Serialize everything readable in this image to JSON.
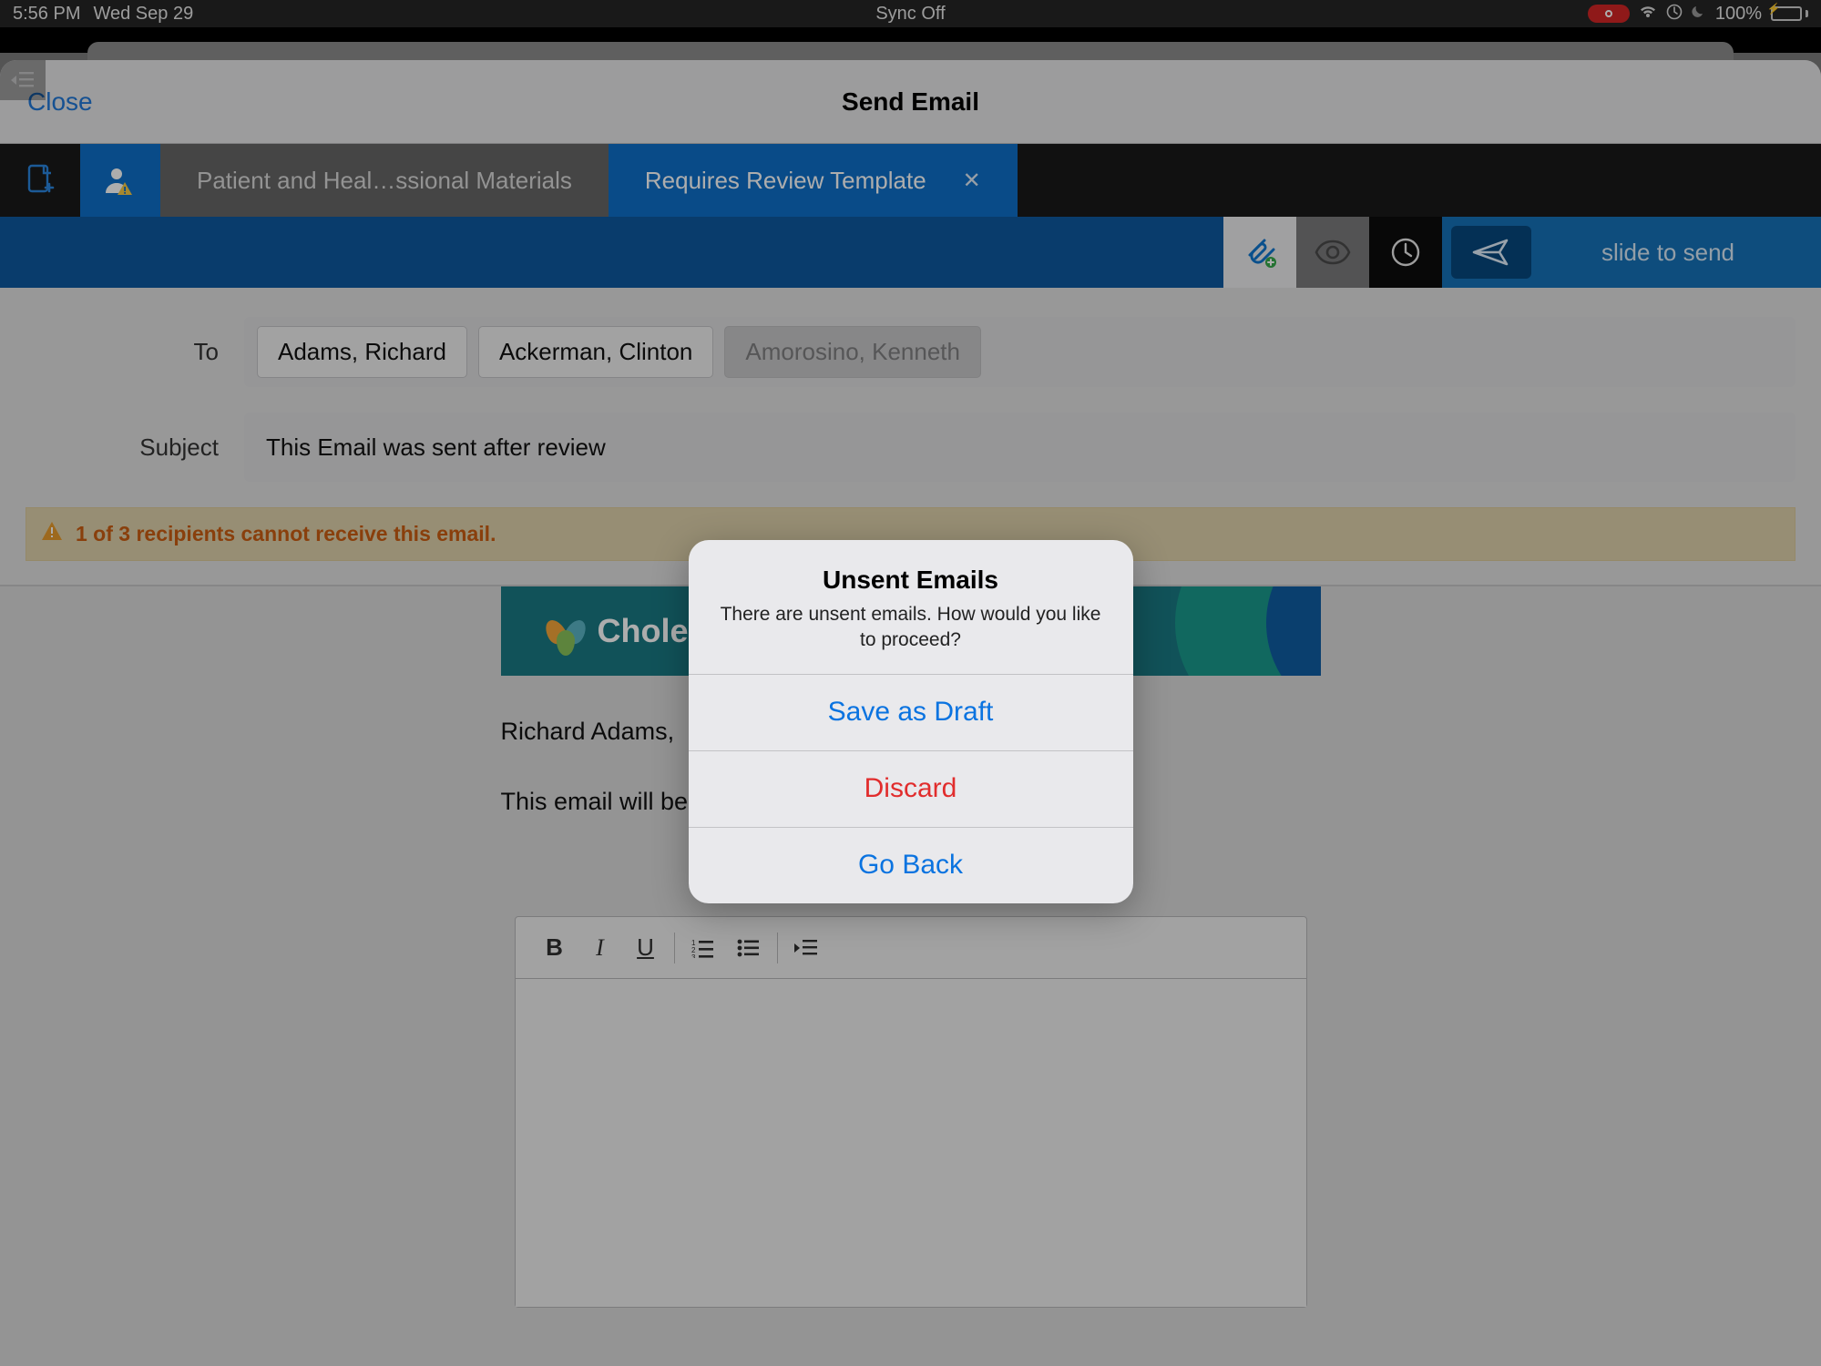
{
  "statusbar": {
    "time": "5:56 PM",
    "date": "Wed Sep 29",
    "center": "Sync Off",
    "battery_pct": "100%"
  },
  "sheet": {
    "close": "Close",
    "title": "Send Email"
  },
  "tabs": {
    "inactive": "Patient and Heal…ssional Materials",
    "active": "Requires Review Template"
  },
  "actionbar": {
    "slide_label": "slide to send"
  },
  "compose": {
    "to_label": "To",
    "subject_label": "Subject",
    "recipients": [
      {
        "name": "Adams, Richard",
        "disabled": false
      },
      {
        "name": "Ackerman, Clinton",
        "disabled": false
      },
      {
        "name": "Amorosino, Kenneth",
        "disabled": true
      }
    ],
    "subject_value": "This Email was sent after review",
    "warning": "1 of 3 recipients cannot receive this email."
  },
  "body": {
    "brand": "CholeCa",
    "greeting": "Richard Adams,",
    "line1_visible": "This email will be revie"
  },
  "editor_toolbar": {
    "bold": "B",
    "italic": "I",
    "underline": "U"
  },
  "alert": {
    "title": "Unsent Emails",
    "message": "There are unsent emails. How would you like to proceed?",
    "save": "Save as Draft",
    "discard": "Discard",
    "goback": "Go Back"
  }
}
